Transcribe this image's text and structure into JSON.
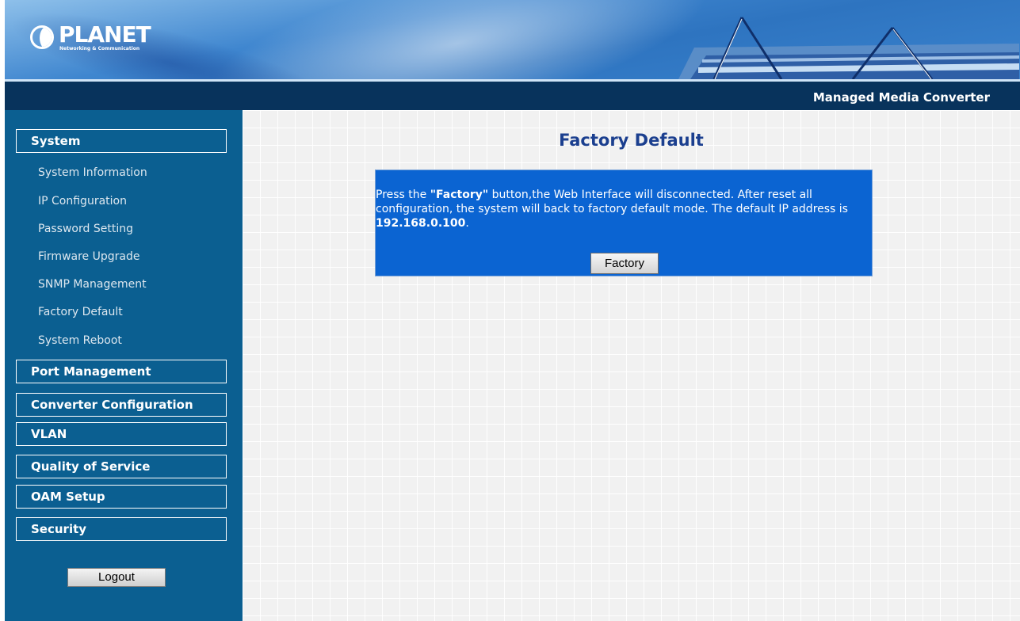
{
  "header": {
    "logo_text": "PLANET",
    "logo_tagline": "Networking & Communication",
    "product_title": "Managed Media Converter"
  },
  "sidebar": {
    "sections": [
      {
        "label": "System",
        "items": [
          "System Information",
          "IP Configuration",
          "Password Setting",
          "Firmware Upgrade",
          "SNMP Management",
          "Factory Default",
          "System Reboot"
        ]
      },
      {
        "label": "Port Management"
      },
      {
        "label": "Converter Configuration"
      },
      {
        "label": "VLAN"
      },
      {
        "label": "Quality of Service"
      },
      {
        "label": "OAM Setup"
      },
      {
        "label": "Security"
      }
    ],
    "logout_label": "Logout"
  },
  "main": {
    "title": "Factory Default",
    "message": {
      "part1": "Press the ",
      "factory_bold": "\"Factory\"",
      "part2": " button,the Web Interface will disconnected. After reset all configuration, the system will back to factory default mode. The default IP address is ",
      "ip_bold": "192.168.0.100",
      "part3": "."
    },
    "factory_button_label": "Factory"
  },
  "colors": {
    "sidebar_bg": "#0b5f91",
    "title_bar_bg": "#08335c",
    "info_box_bg": "#0b64d2",
    "page_title": "#1b3f8f"
  }
}
